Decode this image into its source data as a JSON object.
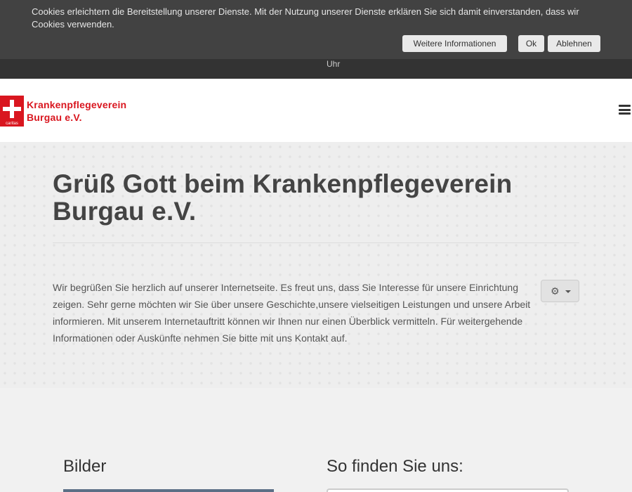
{
  "cookie_banner": {
    "text": "Cookies erleichtern die Bereitstellung unserer Dienste. Mit der Nutzung unserer Dienste erklären Sie sich damit einverstanden, dass wir Cookies verwenden.",
    "more_info_label": "Weitere Informationen",
    "ok_label": "Ok",
    "decline_label": "Ablehnen"
  },
  "topbar": {
    "clock_unit": "Uhr"
  },
  "header": {
    "logo_line1": "Krankenpflegeverein",
    "logo_line2": "Burgau e.V.",
    "logo_sub": "caritas"
  },
  "hero": {
    "title": "Grüß Gott beim Krankenpflegeverein Burgau e.V.",
    "text": "Wir begrüßen Sie herzlich auf unserer Internetseite. Es freut uns, dass Sie Interesse für unsere Einrichtung zeigen. Sehr gerne möchten wir Sie über unsere Geschichte,unsere vielseitigen Leistungen und unsere Arbeit informieren. Mit unserem Internetauftritt können wir Ihnen nur einen Überblick vermitteln. Für weitergehende Informationen oder Auskünfte nehmen Sie bitte mit uns Kontakt auf."
  },
  "sections": {
    "images_title": "Bilder",
    "map_title": "So finden Sie uns:"
  },
  "colors": {
    "brand_red": "#d9161f",
    "topbar": "#333333"
  }
}
